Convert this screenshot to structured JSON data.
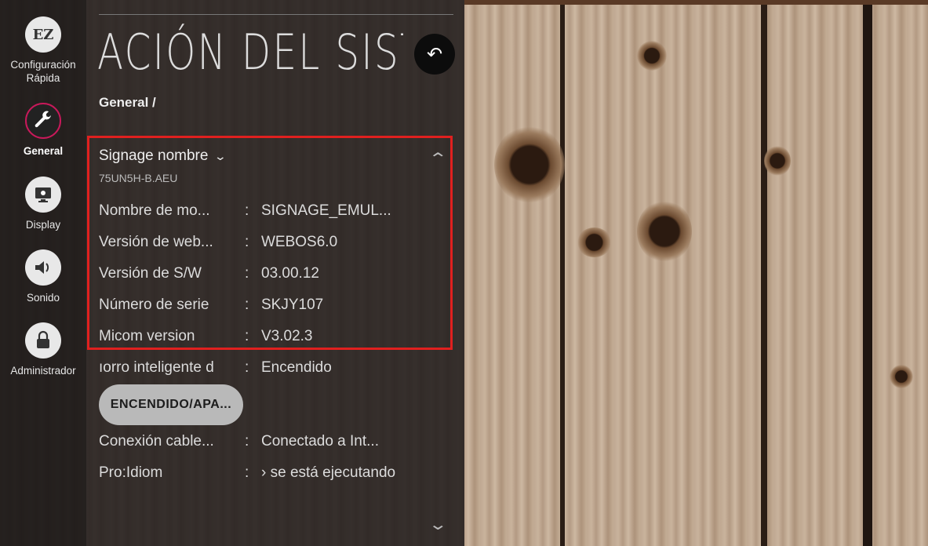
{
  "nav": {
    "items": [
      {
        "icon": "EZ",
        "label": "Configuración Rápida"
      },
      {
        "icon": "wrench-icon",
        "label": "General",
        "active": true
      },
      {
        "icon": "display-icon",
        "label": "Display"
      },
      {
        "icon": "speaker-icon",
        "label": "Sonido"
      },
      {
        "icon": "lock-icon",
        "label": "Administrador"
      }
    ]
  },
  "header": {
    "title": "ACIÓN DEL SIST",
    "back_glyph": "↶",
    "breadcrumb": "General /"
  },
  "section": {
    "title": "Signage nombre",
    "subtitle": "75UN5H-B.AEU",
    "rows": [
      {
        "key": "Nombre de mo...",
        "sep": ":",
        "value": "SIGNAGE_EMUL..."
      },
      {
        "key": "Versión de web...",
        "sep": ":",
        "value": "WEBOS6.0"
      },
      {
        "key": "Versión de S/W",
        "sep": ":",
        "value": "03.00.12"
      },
      {
        "key": "Número de serie",
        "sep": ":",
        "value": "SKJY107"
      },
      {
        "key": "Micom version",
        "sep": ":",
        "value": "V3.02.3"
      }
    ]
  },
  "extra": {
    "ahorro": {
      "key": "ıorro inteligente d",
      "sep": ":",
      "value": "Encendido"
    },
    "pill_label": "ENCENDIDO/APA...",
    "conexion": {
      "key": "Conexión cable...",
      "sep": ":",
      "value": "Conectado a Int..."
    },
    "proidiom": {
      "key": "Pro:Idiom",
      "sep": ":",
      "value": "› se está ejecutando"
    }
  },
  "colors": {
    "accent": "#c8195a",
    "highlight": "#e0201f"
  }
}
